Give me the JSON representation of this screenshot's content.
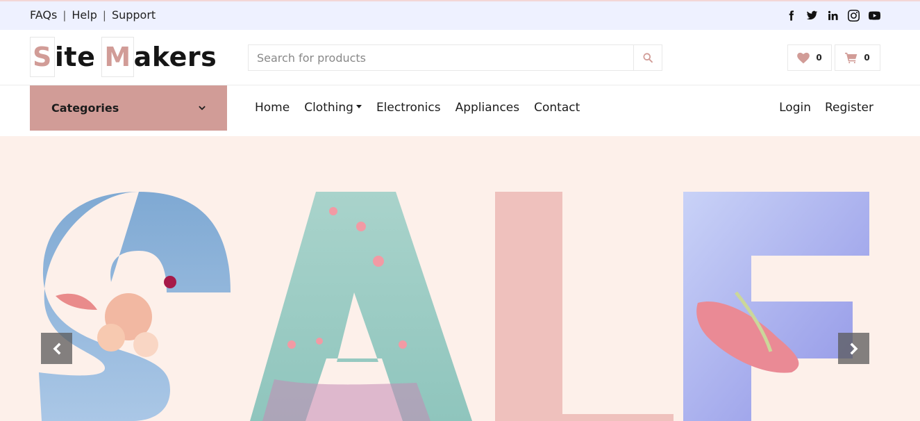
{
  "topbar": {
    "links": [
      "FAQs",
      "Help",
      "Support"
    ],
    "social_icons": [
      "facebook-icon",
      "twitter-icon",
      "linkedin-icon",
      "instagram-icon",
      "youtube-icon"
    ]
  },
  "logo": {
    "first_letter": "S",
    "first_rest": "ite",
    "second_letter": "M",
    "second_rest": "akers",
    "accent_color": "#d19c97"
  },
  "search": {
    "placeholder": "Search for products",
    "icon": "search-icon"
  },
  "wishlist": {
    "icon": "heart-icon",
    "count": "0"
  },
  "cart": {
    "icon": "shopping-cart-icon",
    "count": "0"
  },
  "nav": {
    "categories_label": "Categories",
    "categories_icon": "chevron-down-icon",
    "items": [
      "Home",
      "Clothing",
      "Electronics",
      "Appliances",
      "Contact"
    ],
    "auth": [
      "Login",
      "Register"
    ]
  },
  "hero": {
    "text": "SALE",
    "background": "#fdf0ea",
    "prev_icon": "chevron-left-icon",
    "next_icon": "chevron-right-icon"
  },
  "colors": {
    "primary": "#d19c97",
    "topbar_bg": "#eef1ff",
    "text": "#1c1c1c"
  }
}
